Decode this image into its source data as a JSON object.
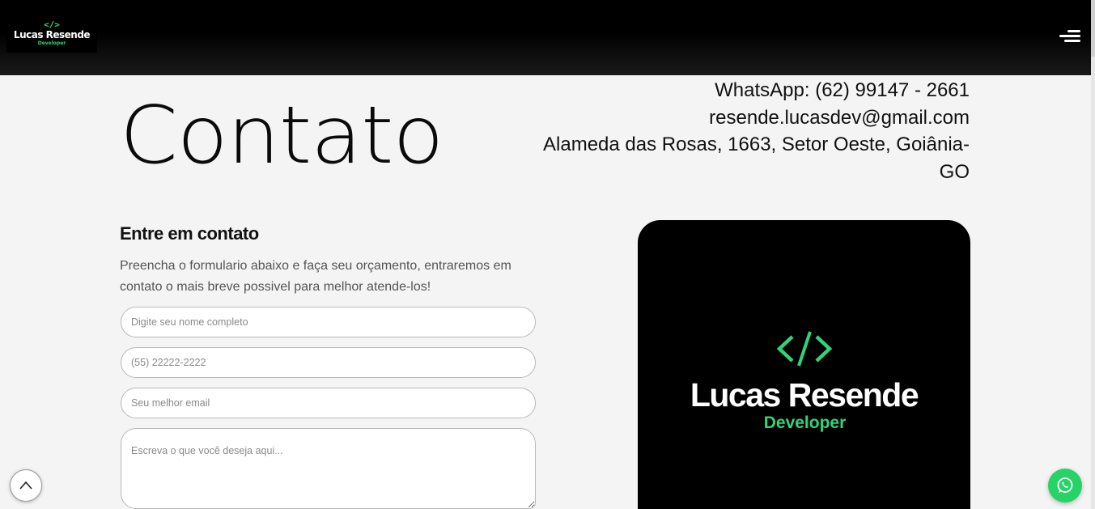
{
  "header": {
    "logo": {
      "code_glyph": "</>",
      "name": "Lucas Resende",
      "subtitle": "Developer"
    },
    "menu_icon": "hamburger-menu-icon"
  },
  "hero": {
    "title": "Contato",
    "contact": {
      "whatsapp": "WhatsApp: (62) 99147 - 2661",
      "email": "resende.lucasdev@gmail.com",
      "address_line1": "Alameda das Rosas, 1663, Setor Oeste, Goiânia-",
      "address_line2": "GO"
    }
  },
  "form": {
    "title": "Entre em contato",
    "description": "Preencha o formulario abaixo e faça seu orçamento, entraremos em contato o mais breve possivel para melhor atende-los!",
    "name_placeholder": "Digite seu nome completo",
    "phone_placeholder": "(55) 22222-2222",
    "email_placeholder": "Seu melhor email",
    "message_placeholder": "Escreva o que você deseja aqui..."
  },
  "card": {
    "name": "Lucas Resende",
    "subtitle": "Developer"
  },
  "floating": {
    "scroll_top_icon": "chevron-up-icon",
    "whatsapp_icon": "whatsapp-icon"
  },
  "colors": {
    "accent": "#2fd47a",
    "whatsapp": "#25d366",
    "background": "#f4f4f4",
    "header": "#000000"
  }
}
